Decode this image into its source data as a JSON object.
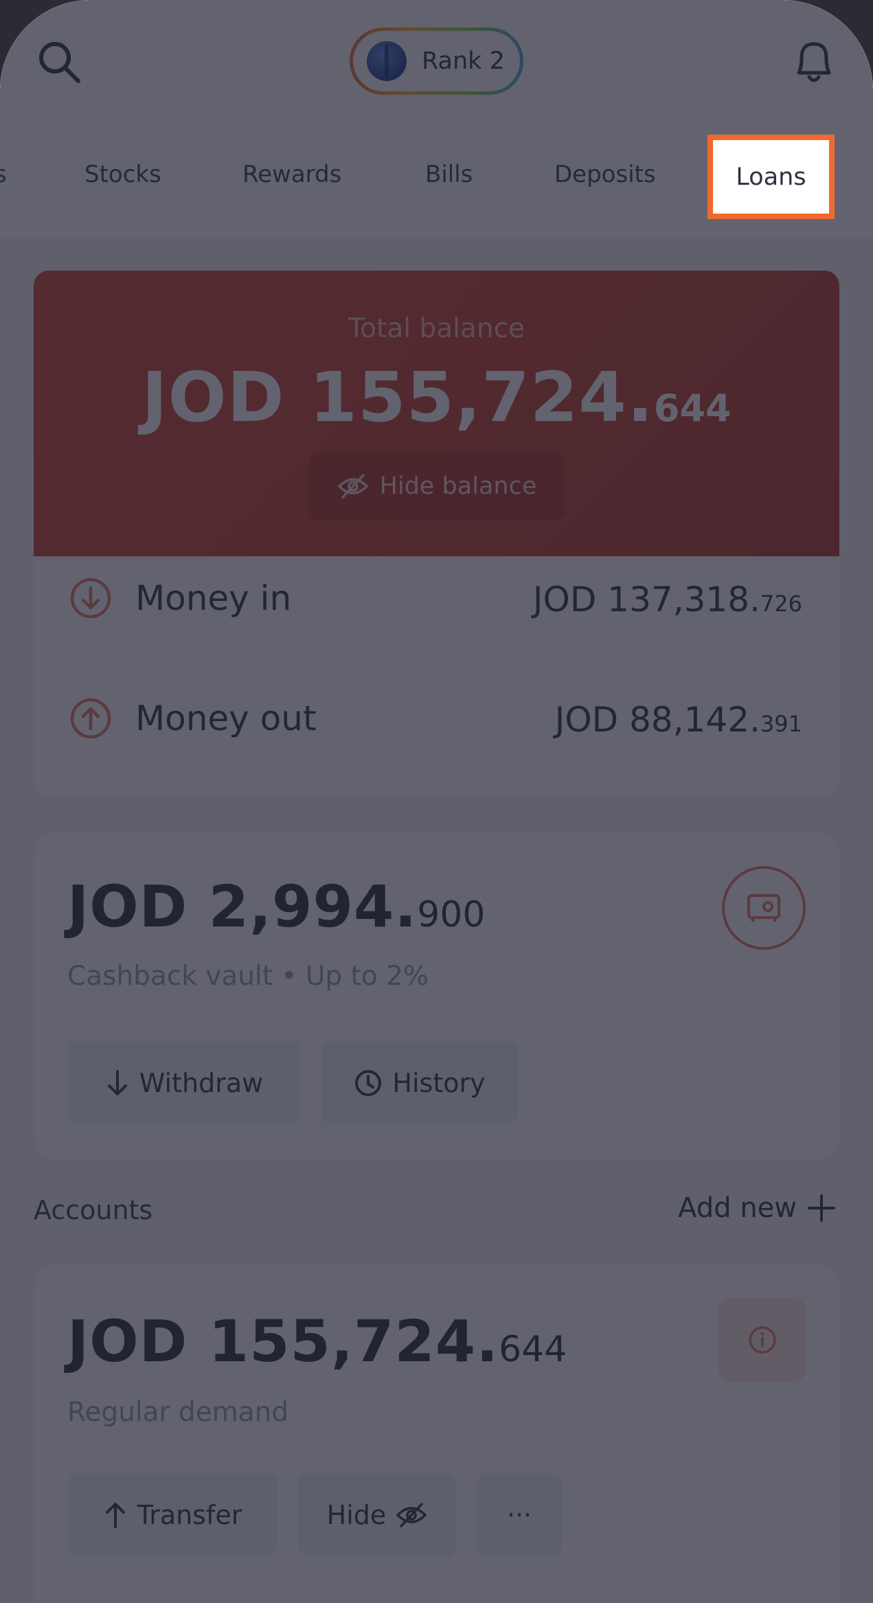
{
  "header": {
    "rank_label": "Rank 2",
    "search_icon": "search-icon",
    "notification_icon": "bell-icon"
  },
  "tabs": {
    "clipped": "s",
    "items": [
      "Stocks",
      "Rewards",
      "Bills",
      "Deposits"
    ],
    "active": "Loans"
  },
  "balance": {
    "label": "Total balance",
    "amount_main": "JOD 155,724.",
    "amount_cents": "644",
    "hide_label": "Hide balance"
  },
  "flows": {
    "money_in_label": "Money in",
    "money_in_main": "JOD 137,318.",
    "money_in_cents": "726",
    "money_out_label": "Money out",
    "money_out_main": "JOD 88,142.",
    "money_out_cents": "391"
  },
  "vault": {
    "amount_main": "JOD 2,994.",
    "amount_cents": "900",
    "subtitle": "Cashback vault • Up to 2%",
    "withdraw_label": "Withdraw",
    "history_label": "History"
  },
  "accounts": {
    "section_label": "Accounts",
    "add_new_label": "Add new",
    "account": {
      "amount_main": "JOD 155,724.",
      "amount_cents": "644",
      "subtitle": "Regular demand",
      "transfer_label": "Transfer",
      "hide_label": "Hide",
      "more_label": "···"
    }
  },
  "colors": {
    "accent": "#ef6a2c",
    "balance_card": "#c43d29",
    "overlay": "#1f2132"
  }
}
